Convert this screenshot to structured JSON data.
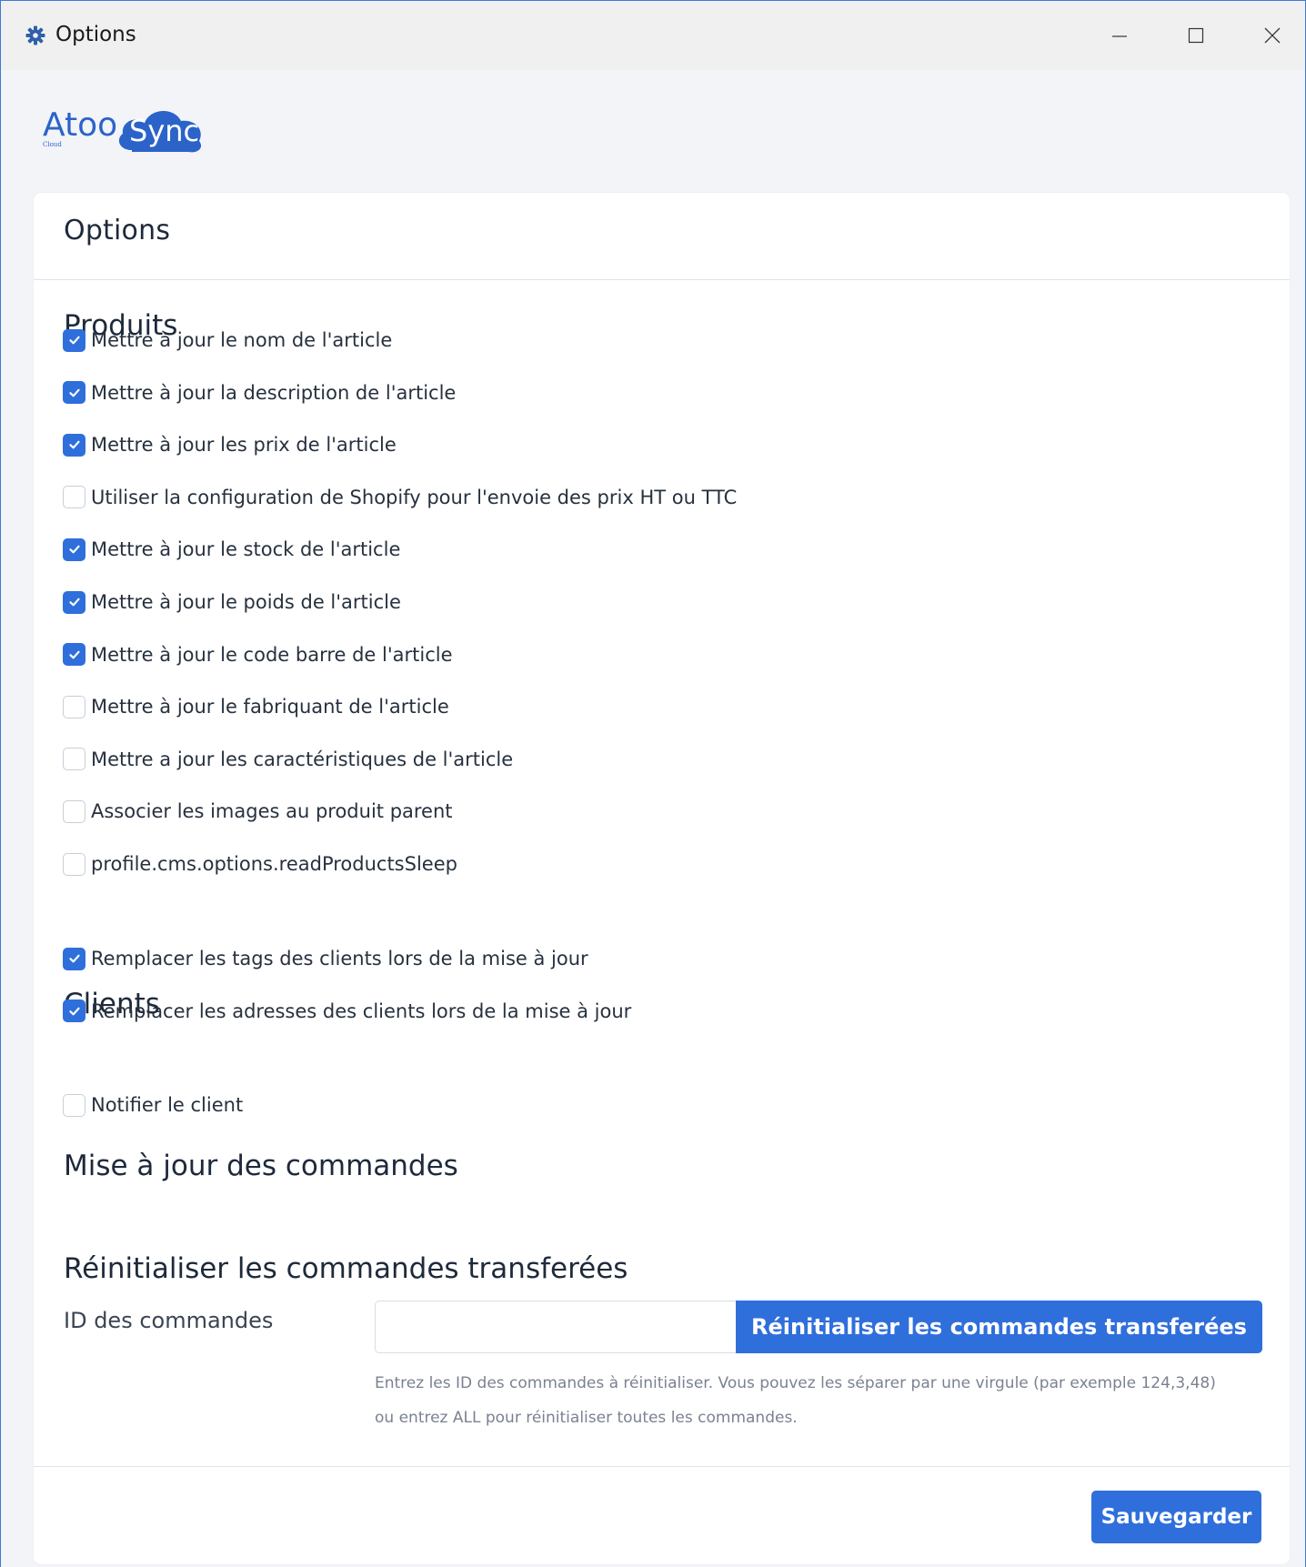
{
  "window": {
    "title": "Options",
    "icon": "gear-icon",
    "controls": {
      "minimize": "minimize-icon",
      "maximize": "maximize-icon",
      "close": "close-icon"
    }
  },
  "logo": {
    "word1": "Atoo",
    "word2": "Sync",
    "sub": "Cloud"
  },
  "card": {
    "title": "Options",
    "produits": {
      "title": "Produits",
      "items": [
        {
          "label": "Mettre à jour le nom de l'article",
          "checked": true
        },
        {
          "label": "Mettre à jour la description de l'article",
          "checked": true
        },
        {
          "label": "Mettre à jour les prix de l'article",
          "checked": true
        },
        {
          "label": "Utiliser la configuration de Shopify pour l'envoie des prix HT ou TTC",
          "checked": false
        },
        {
          "label": "Mettre à jour le stock de l'article",
          "checked": true
        },
        {
          "label": "Mettre à jour le poids de l'article",
          "checked": true
        },
        {
          "label": "Mettre à jour le code barre de l'article",
          "checked": true
        },
        {
          "label": "Mettre à jour le fabriquant de l'article",
          "checked": false
        },
        {
          "label": "Mettre a jour les caractéristiques de l'article",
          "checked": false
        },
        {
          "label": "Associer les images au produit parent",
          "checked": false
        },
        {
          "label": "profile.cms.options.readProductsSleep",
          "checked": false
        }
      ]
    },
    "clients": {
      "title": "Clients",
      "items": [
        {
          "label": "Remplacer les tags des clients lors de la mise à jour",
          "checked": true
        },
        {
          "label": "Remplacer les adresses des clients lors de la mise à jour",
          "checked": true
        }
      ]
    },
    "commandes": {
      "title": "Mise à jour des commandes",
      "items": [
        {
          "label": "Notifier le client",
          "checked": false
        }
      ]
    },
    "reset": {
      "title": "Réinitialiser les commandes transferées",
      "id_label": "ID des commandes",
      "input_value": "",
      "input_placeholder": "",
      "button_label": "Réinitialiser les commandes transferées",
      "help_line1": "Entrez les ID des commandes à réinitialiser. Vous pouvez les séparer par une virgule (par exemple 124,3,48)",
      "help_line2": "ou entrez ALL pour réinitialiser toutes les commandes."
    },
    "save_label": "Sauvegarder"
  },
  "colors": {
    "accent": "#2f6fdb",
    "window_border": "#3b7ad8",
    "logo_blue": "#2b63c9"
  }
}
